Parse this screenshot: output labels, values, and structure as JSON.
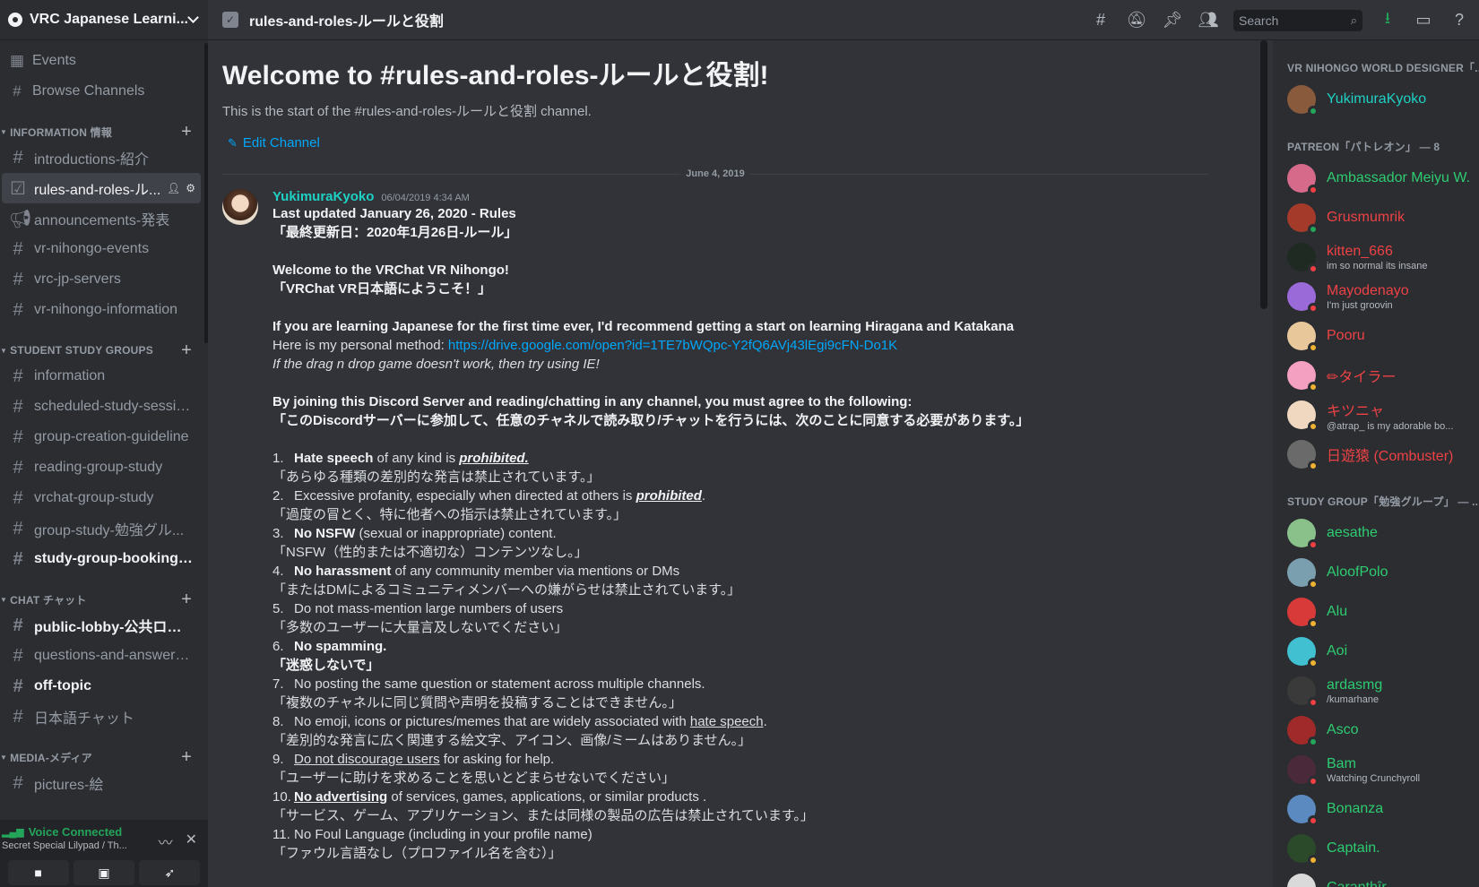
{
  "server": {
    "name": "VRC Japanese Learni..."
  },
  "sidebar": {
    "top_items": [
      {
        "label": "Events",
        "icon": "calendar-icon"
      },
      {
        "label": "Browse Channels",
        "icon": "browse-channels-icon"
      }
    ],
    "categories": [
      {
        "name": "INFORMATION 情報",
        "channels": [
          {
            "name": "introductions-紹介",
            "state": "normal"
          },
          {
            "name": "rules-and-roles-ル...",
            "state": "active"
          },
          {
            "name": "announcements-発表",
            "state": "normal"
          },
          {
            "name": "vr-nihongo-events",
            "state": "normal"
          },
          {
            "name": "vrc-jp-servers",
            "state": "normal"
          },
          {
            "name": "vr-nihongo-information",
            "state": "normal"
          }
        ]
      },
      {
        "name": "STUDENT STUDY GROUPS",
        "channels": [
          {
            "name": "information",
            "state": "normal"
          },
          {
            "name": "scheduled-study-sessions",
            "state": "normal"
          },
          {
            "name": "group-creation-guideline",
            "state": "normal"
          },
          {
            "name": "reading-group-study",
            "state": "normal"
          },
          {
            "name": "vrchat-group-study",
            "state": "normal"
          },
          {
            "name": "group-study-勉強グル...",
            "state": "normal"
          },
          {
            "name": "study-group-booking-ch...",
            "state": "unread"
          }
        ]
      },
      {
        "name": "CHAT チャット",
        "channels": [
          {
            "name": "public-lobby-公共ロビー",
            "state": "unread"
          },
          {
            "name": "questions-and-answers-...",
            "state": "normal"
          },
          {
            "name": "off-topic",
            "state": "unread"
          },
          {
            "name": "日本語チャット",
            "state": "normal"
          }
        ]
      },
      {
        "name": "MEDIA-メディア",
        "channels": [
          {
            "name": "pictures-絵",
            "state": "normal"
          }
        ]
      }
    ],
    "voice": {
      "status": "Voice Connected",
      "channel": "Secret Special Lilypad / Th..."
    }
  },
  "header": {
    "channel": "rules-and-roles-ルールと役割",
    "search_placeholder": "Search"
  },
  "welcome": {
    "title": "Welcome to #rules-and-roles-ルールと役割!",
    "subtitle": "This is the start of the #rules-and-roles-ルールと役割 channel.",
    "edit": "Edit Channel"
  },
  "divider_date": "June 4, 2019",
  "message": {
    "author": "YukimuraKyoko",
    "timestamp": "06/04/2019 4:34 AM",
    "lines": {
      "l1": "Last updated January 26, 2020 - Rules",
      "l2": "「最終更新日：2020年1月26日-ルール」",
      "l3": "Welcome to the VRChat VR Nihongo!",
      "l4": "「VRChat VR日本語にようこそ！」",
      "l5": "If you are learning Japanese for the first time ever, I'd recommend getting a start on learning Hiragana and Katakana",
      "l6a": "Here is my personal method: ",
      "l6b": "https://drive.google.com/open?id=1TE7bWQpc-Y2fQ6AVj43lEgi9cFN-Do1K",
      "l7": "If the drag n drop game doesn't work, then try using IE!",
      "l8": "By joining this Discord Server and reading/chatting in any channel, you must agree to the following:",
      "l9": "「このDiscordサーバーに参加して、任意のチャネルで読み取り/チャットを行うには、次のことに同意する必要があります。」"
    },
    "rules": [
      {
        "num": "1.",
        "a": "Hate speech",
        "b": " of any kind is ",
        "c": "prohibited.",
        "jp": "「あらゆる種類の差別的な発言は禁止されています。」"
      },
      {
        "num": "2.",
        "a": "Excessive profanity, especially when directed at others is ",
        "b": "prohibited",
        "c": ".",
        "jp": "「過度の冒とく、特に他者への指示は禁止されています。」"
      },
      {
        "num": "3.",
        "a": "No NSFW",
        "b": " (sexual or inappropriate) content.",
        "jp": "「NSFW（性的または不適切な）コンテンツなし。」"
      },
      {
        "num": "4.",
        "a": "No harassment",
        "b": " of any community member via mentions or DMs",
        "jp": "「またはDMによるコミュニティメンバーへの嫌がらせは禁止されています。」"
      },
      {
        "num": "5.",
        "a": "Do not mass-mention large numbers of users",
        "jp": "「多数のユーザーに大量言及しないでください」"
      },
      {
        "num": "6.",
        "a": "No spamming.",
        "jp": "「迷惑しないで」"
      },
      {
        "num": "7.",
        "a": "No posting the same question or statement across multiple channels.",
        "jp": "「複数のチャネルに同じ質問や声明を投稿することはできません。」"
      },
      {
        "num": "8.",
        "a": "No emoji, icons or pictures/memes that are widely associated with ",
        "b": "hate speech",
        "c": ".",
        "jp": "「差別的な発言に広く関連する絵文字、アイコン、画像/ミームはありません。」"
      },
      {
        "num": "9.",
        "a": "Do not discourage users",
        "b": " for asking for help.",
        "jp": "「ユーザーに助けを求めることを思いとどまらせないでください」"
      },
      {
        "num": "10.",
        "a": "No advertising",
        "b": " of services, games, applications, or similar products .",
        "jp": "「サービス、ゲーム、アプリケーション、または同様の製品の広告は禁止されています。」"
      },
      {
        "num": "11.",
        "a": "No Foul Language (including in your profile name)",
        "jp": "「ファウル言語なし（プロファイル名を含む）」"
      }
    ]
  },
  "members": {
    "groups": [
      {
        "title": "VR NIHONGO WORLD DESIGNER「...",
        "people": [
          {
            "name": "YukimuraKyoko",
            "status": "",
            "color": "#1fd1c4",
            "presence": "on",
            "avatar": "#8a5a3c"
          }
        ]
      },
      {
        "title": "PATREON「パトレオン」 — 8",
        "people": [
          {
            "name": "Ambassador Meiyu W...",
            "status": "",
            "color": "#2ecc71",
            "presence": "dnd",
            "avatar": "#d66a8a"
          },
          {
            "name": "Grusmumrik",
            "status": "",
            "color": "#ed4245",
            "presence": "on",
            "avatar": "#a33a2a"
          },
          {
            "name": "kitten_666",
            "status": "im so normal its insane",
            "color": "#ed4245",
            "presence": "dnd",
            "avatar": "#1e2a22"
          },
          {
            "name": "Mayodenayo",
            "status": "I'm just groovin",
            "color": "#ed4245",
            "presence": "dnd",
            "avatar": "#9a6ad8"
          },
          {
            "name": "Pooru",
            "status": "",
            "color": "#ed4245",
            "presence": "idle",
            "avatar": "#e8c89a"
          },
          {
            "name": "✏タイラー",
            "status": "",
            "color": "#ed4245",
            "presence": "idle",
            "avatar": "#f4a0c0"
          },
          {
            "name": "キツニャ",
            "status": "@atrap_ is my adorable bo...",
            "color": "#ed4245",
            "presence": "idle",
            "avatar": "#f0d8c0"
          },
          {
            "name": "日遊猿 (Combuster)",
            "status": "",
            "color": "#ed4245",
            "presence": "idle",
            "avatar": "#6a6a6a"
          }
        ]
      },
      {
        "title": "STUDY GROUP「勉強グループ」 — ...",
        "people": [
          {
            "name": "aesathe",
            "status": "",
            "color": "#2ecc71",
            "presence": "dnd",
            "avatar": "#8ac08a"
          },
          {
            "name": "AloofPolo",
            "status": "",
            "color": "#2ecc71",
            "presence": "idle",
            "avatar": "#7aa0b0"
          },
          {
            "name": "Alu",
            "status": "",
            "color": "#2ecc71",
            "presence": "idle",
            "avatar": "#d83a3a"
          },
          {
            "name": "Aoi",
            "status": "",
            "color": "#2ecc71",
            "presence": "idle",
            "avatar": "#40c0d0"
          },
          {
            "name": "ardasmg",
            "status": "/kumarhane",
            "color": "#2ecc71",
            "presence": "dnd",
            "avatar": "#3a3a3a"
          },
          {
            "name": "Asco",
            "status": "",
            "color": "#2ecc71",
            "presence": "on",
            "avatar": "#a02a2a"
          },
          {
            "name": "Bam",
            "status": "Watching Crunchyroll",
            "color": "#2ecc71",
            "presence": "dnd",
            "avatar": "#4a2a3a"
          },
          {
            "name": "Bonanza",
            "status": "",
            "color": "#2ecc71",
            "presence": "dnd",
            "avatar": "#5a8ac0"
          },
          {
            "name": "Captain.",
            "status": "",
            "color": "#2ecc71",
            "presence": "idle",
            "avatar": "#2a4a2a"
          },
          {
            "name": "Caranthîr",
            "status": "",
            "color": "#2ecc71",
            "presence": "dnd",
            "avatar": "#dadada"
          }
        ]
      }
    ]
  }
}
